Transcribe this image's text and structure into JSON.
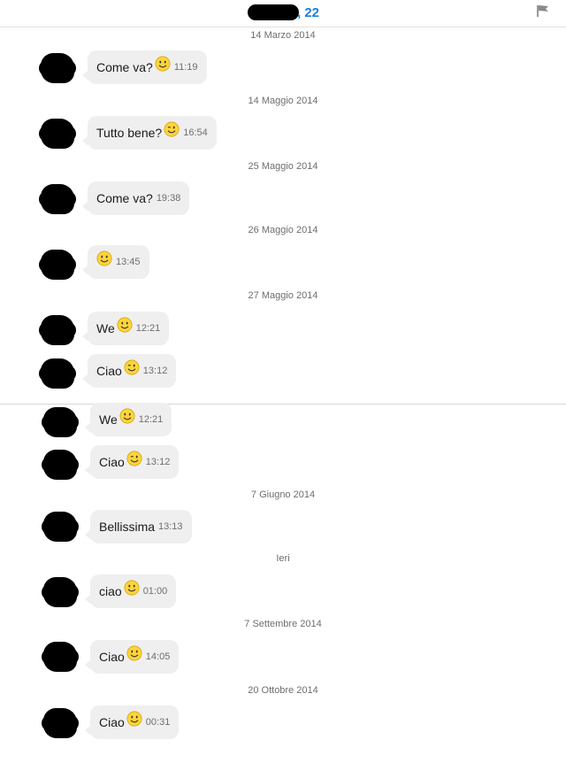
{
  "header": {
    "age_label": ", 22"
  },
  "dates": {
    "d1": "14 Marzo 2014",
    "d2": "14 Maggio 2014",
    "d3": "25 Maggio 2014",
    "d4": "26 Maggio 2014",
    "d5": "27 Maggio 2014",
    "d6": "7 Giugno 2014",
    "d7": "Ieri",
    "d8": "7 Settembre 2014",
    "d9": "20 Ottobre 2014"
  },
  "messages": [
    {
      "text": "Come va?",
      "emoji": "smile-emoji",
      "time": "11:19"
    },
    {
      "text": "Tutto bene?",
      "emoji": "wink-emoji",
      "time": "16:54"
    },
    {
      "text": "Come va?",
      "emoji": "",
      "time": "19:38"
    },
    {
      "text": "",
      "emoji": "smile-emoji",
      "time": "13:45"
    },
    {
      "text": "We",
      "emoji": "smile-emoji",
      "time": "12:21"
    },
    {
      "text": "Ciao",
      "emoji": "wink-emoji",
      "time": "13:12"
    },
    {
      "text": "We",
      "emoji": "smile-emoji",
      "time": "12:21"
    },
    {
      "text": "Ciao",
      "emoji": "wink-emoji",
      "time": "13:12"
    },
    {
      "text": "Bellissima",
      "emoji": "",
      "time": "13:13"
    },
    {
      "text": "ciao",
      "emoji": "smile-emoji",
      "time": "01:00"
    },
    {
      "text": "Ciao",
      "emoji": "smile-emoji",
      "time": "14:05"
    },
    {
      "text": "Ciao",
      "emoji": "smile-emoji",
      "time": "00:31"
    }
  ],
  "colors": {
    "accent": "#1a7fd8",
    "bubble": "#efefef",
    "emoji": "#ffd43a"
  }
}
